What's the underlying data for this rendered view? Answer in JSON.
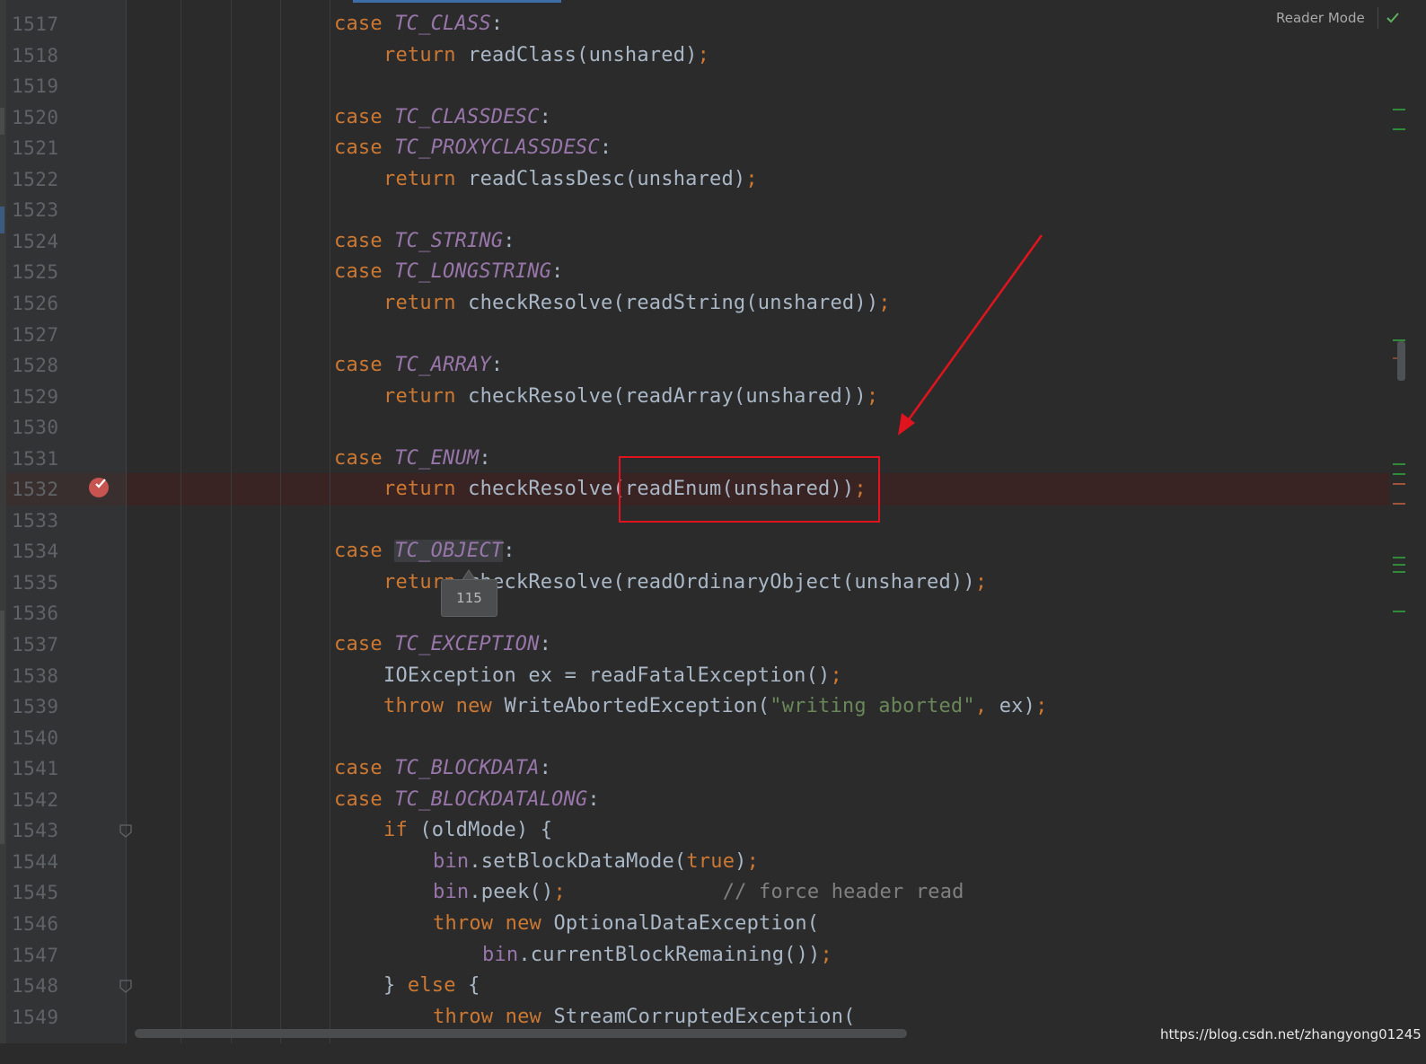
{
  "toolbar": {
    "reader_mode_label": "Reader Mode",
    "status_icon": "check-icon"
  },
  "breakpoint": {
    "line": "1532",
    "icon": "breakpoint-icon"
  },
  "tooltip": {
    "text": "115"
  },
  "watermark": "https://blog.csdn.net/zhangyong01245",
  "colors": {
    "keyword": "#cc7832",
    "constant": "#9876aa",
    "string": "#6a8759",
    "comment": "#808080",
    "text": "#a9b7c6",
    "annotation_red": "#e0141e",
    "breakpoint_red": "#c75450"
  },
  "lines": [
    {
      "num": "1517",
      "indent": 2,
      "tokens": [
        [
          "kw",
          "case "
        ],
        [
          "const",
          "TC_CLASS"
        ],
        [
          "plain",
          ":"
        ]
      ]
    },
    {
      "num": "1518",
      "indent": 3,
      "tokens": [
        [
          "kw",
          "return "
        ],
        [
          "plain",
          "readClass(unshared)"
        ],
        [
          "semi",
          ";"
        ]
      ]
    },
    {
      "num": "1519",
      "indent": 0,
      "tokens": []
    },
    {
      "num": "1520",
      "indent": 2,
      "tokens": [
        [
          "kw",
          "case "
        ],
        [
          "const",
          "TC_CLASSDESC"
        ],
        [
          "plain",
          ":"
        ]
      ]
    },
    {
      "num": "1521",
      "indent": 2,
      "tokens": [
        [
          "kw",
          "case "
        ],
        [
          "const",
          "TC_PROXYCLASSDESC"
        ],
        [
          "plain",
          ":"
        ]
      ]
    },
    {
      "num": "1522",
      "indent": 3,
      "tokens": [
        [
          "kw",
          "return "
        ],
        [
          "plain",
          "readClassDesc(unshared)"
        ],
        [
          "semi",
          ";"
        ]
      ]
    },
    {
      "num": "1523",
      "indent": 0,
      "tokens": []
    },
    {
      "num": "1524",
      "indent": 2,
      "tokens": [
        [
          "kw",
          "case "
        ],
        [
          "const",
          "TC_STRING"
        ],
        [
          "plain",
          ":"
        ]
      ]
    },
    {
      "num": "1525",
      "indent": 2,
      "tokens": [
        [
          "kw",
          "case "
        ],
        [
          "const",
          "TC_LONGSTRING"
        ],
        [
          "plain",
          ":"
        ]
      ]
    },
    {
      "num": "1526",
      "indent": 3,
      "tokens": [
        [
          "kw",
          "return "
        ],
        [
          "plain",
          "checkResolve(readString(unshared))"
        ],
        [
          "semi",
          ";"
        ]
      ]
    },
    {
      "num": "1527",
      "indent": 0,
      "tokens": []
    },
    {
      "num": "1528",
      "indent": 2,
      "tokens": [
        [
          "kw",
          "case "
        ],
        [
          "const",
          "TC_ARRAY"
        ],
        [
          "plain",
          ":"
        ]
      ]
    },
    {
      "num": "1529",
      "indent": 3,
      "tokens": [
        [
          "kw",
          "return "
        ],
        [
          "plain",
          "checkResolve(readArray(unshared))"
        ],
        [
          "semi",
          ";"
        ]
      ]
    },
    {
      "num": "1530",
      "indent": 0,
      "tokens": []
    },
    {
      "num": "1531",
      "indent": 2,
      "tokens": [
        [
          "kw",
          "case "
        ],
        [
          "const",
          "TC_ENUM"
        ],
        [
          "plain",
          ":"
        ]
      ]
    },
    {
      "num": "1532",
      "indent": 3,
      "tokens": [
        [
          "kw",
          "return "
        ],
        [
          "plain",
          "checkResolve(readEnum(unshared))"
        ],
        [
          "semi",
          ";"
        ]
      ]
    },
    {
      "num": "1533",
      "indent": 0,
      "tokens": []
    },
    {
      "num": "1534",
      "indent": 2,
      "tokens": [
        [
          "kw",
          "case "
        ],
        [
          "const hl",
          "TC_OBJECT"
        ],
        [
          "plain",
          ":"
        ]
      ]
    },
    {
      "num": "1535",
      "indent": 3,
      "tokens": [
        [
          "kw",
          "return "
        ],
        [
          "plain",
          "checkResolve(readOrdinaryObject(unshared))"
        ],
        [
          "semi",
          ";"
        ]
      ]
    },
    {
      "num": "1536",
      "indent": 0,
      "tokens": []
    },
    {
      "num": "1537",
      "indent": 2,
      "tokens": [
        [
          "kw",
          "case "
        ],
        [
          "const",
          "TC_EXCEPTION"
        ],
        [
          "plain",
          ":"
        ]
      ]
    },
    {
      "num": "1538",
      "indent": 3,
      "tokens": [
        [
          "plain",
          "IOException ex = readFatalException()"
        ],
        [
          "semi",
          ";"
        ]
      ]
    },
    {
      "num": "1539",
      "indent": 3,
      "tokens": [
        [
          "kw",
          "throw new "
        ],
        [
          "plain",
          "WriteAbortedException("
        ],
        [
          "str",
          "\"writing aborted\""
        ],
        [
          "semi",
          ", "
        ],
        [
          "plain",
          "ex)"
        ],
        [
          "semi",
          ";"
        ]
      ]
    },
    {
      "num": "1540",
      "indent": 0,
      "tokens": []
    },
    {
      "num": "1541",
      "indent": 2,
      "tokens": [
        [
          "kw",
          "case "
        ],
        [
          "const",
          "TC_BLOCKDATA"
        ],
        [
          "plain",
          ":"
        ]
      ]
    },
    {
      "num": "1542",
      "indent": 2,
      "tokens": [
        [
          "kw",
          "case "
        ],
        [
          "const",
          "TC_BLOCKDATALONG"
        ],
        [
          "plain",
          ":"
        ]
      ]
    },
    {
      "num": "1543",
      "indent": 3,
      "tokens": [
        [
          "kw",
          "if "
        ],
        [
          "plain",
          "(oldMode) {"
        ]
      ]
    },
    {
      "num": "1544",
      "indent": 4,
      "tokens": [
        [
          "field",
          "bin"
        ],
        [
          "plain",
          ".setBlockDataMode("
        ],
        [
          "kw",
          "true"
        ],
        [
          "plain",
          ")"
        ],
        [
          "semi",
          ";"
        ]
      ]
    },
    {
      "num": "1545",
      "indent": 4,
      "tokens": [
        [
          "field",
          "bin"
        ],
        [
          "plain",
          ".peek()"
        ],
        [
          "semi",
          ";"
        ],
        [
          "plain",
          "             "
        ],
        [
          "cmt",
          "// force header read"
        ]
      ]
    },
    {
      "num": "1546",
      "indent": 4,
      "tokens": [
        [
          "kw",
          "throw new "
        ],
        [
          "plain",
          "OptionalDataException("
        ]
      ]
    },
    {
      "num": "1547",
      "indent": 5,
      "tokens": [
        [
          "field",
          "bin"
        ],
        [
          "plain",
          ".currentBlockRemaining())"
        ],
        [
          "semi",
          ";"
        ]
      ]
    },
    {
      "num": "1548",
      "indent": 3,
      "tokens": [
        [
          "plain",
          "} "
        ],
        [
          "kw",
          "else "
        ],
        [
          "plain",
          "{"
        ]
      ]
    },
    {
      "num": "1549",
      "indent": 4,
      "tokens": [
        [
          "kw",
          "throw new "
        ],
        [
          "plain",
          "StreamCorruptedException("
        ]
      ]
    }
  ]
}
